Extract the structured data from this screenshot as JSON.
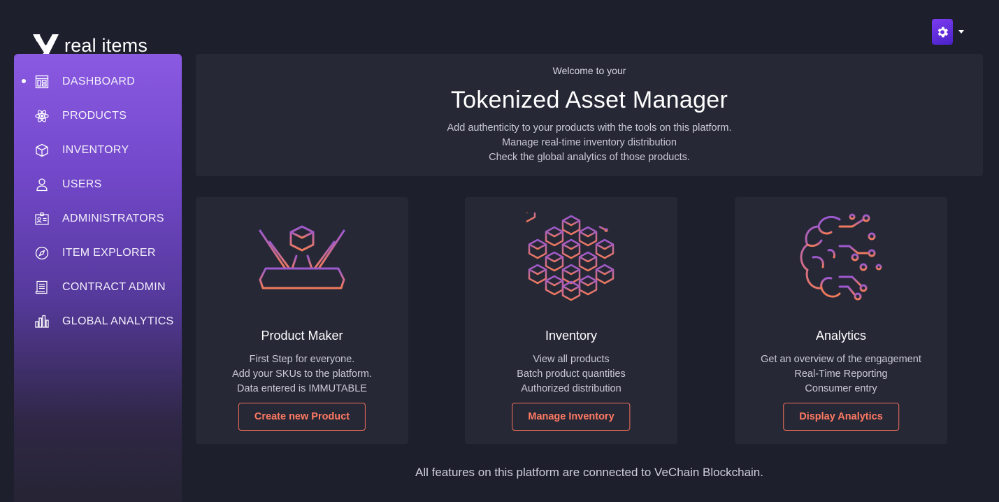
{
  "app": {
    "logo_text": "real items"
  },
  "header": {
    "avatar_icon": "gear-icon",
    "avatar_color": "#6a30e0"
  },
  "sidebar": {
    "active_index": 0,
    "items": [
      {
        "label": "DASHBOARD",
        "icon": "dashboard-icon"
      },
      {
        "label": "PRODUCTS",
        "icon": "atom-icon"
      },
      {
        "label": "INVENTORY",
        "icon": "box-icon"
      },
      {
        "label": "USERS",
        "icon": "user-icon"
      },
      {
        "label": "ADMINISTRATORS",
        "icon": "id-badge-icon"
      },
      {
        "label": "ITEM EXPLORER",
        "icon": "compass-icon"
      },
      {
        "label": "CONTRACT ADMIN",
        "icon": "document-icon"
      },
      {
        "label": "GLOBAL ANALYTICS",
        "icon": "bar-chart-icon"
      }
    ]
  },
  "banner": {
    "welcome": "Welcome to your",
    "title": "Tokenized Asset Manager",
    "lines": [
      "Add authenticity to your products with the tools on this platform.",
      "Manage real-time inventory distribution",
      "Check the global analytics of those products."
    ]
  },
  "cards": [
    {
      "icon": "hologram-cube-icon",
      "title": "Product Maker",
      "lines": [
        "First Step for everyone.",
        "Add your SKUs to the platform.",
        "Data entered is IMMUTABLE"
      ],
      "button": "Create new Product"
    },
    {
      "icon": "blockchain-cubes-icon",
      "title": "Inventory",
      "lines": [
        "View all products",
        "Batch product quantities",
        "Authorized distribution"
      ],
      "button": "Manage Inventory"
    },
    {
      "icon": "brain-circuit-icon",
      "title": "Analytics",
      "lines": [
        "Get an overview of the engagement",
        "Real-Time Reporting",
        "Consumer entry"
      ],
      "button": "Display Analytics"
    }
  ],
  "footer": {
    "note": "All features on this platform are connected to VeChain Blockchain."
  },
  "colors": {
    "background": "#1e1f2d",
    "panel": "#272836",
    "accent": "#ff7a62",
    "gradient_start": "#9b59d0",
    "gradient_end": "#f07a5a"
  }
}
